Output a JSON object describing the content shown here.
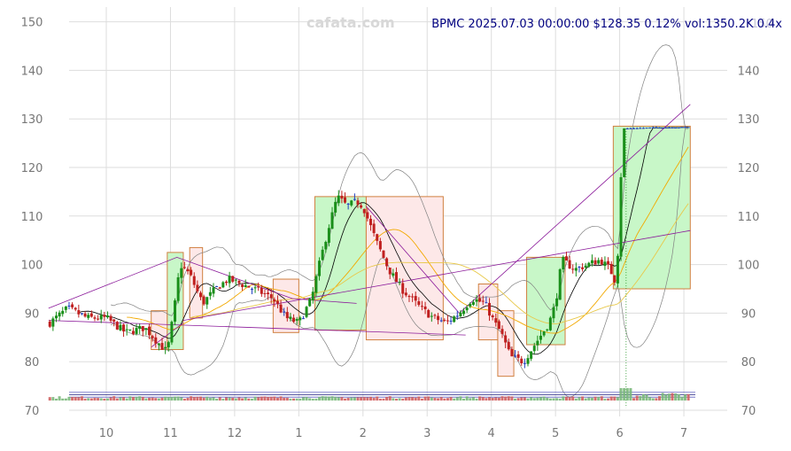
{
  "header": {
    "watermark": "cafata.com",
    "info": "BPMC 2025.07.03 00:00:00 $128.35 0.12% vol:1350.2K 0.4x",
    "overlay_num": "150"
  },
  "colors": {
    "up": "#1a8f1a",
    "down": "#c02020",
    "flat": "#1f3fbf",
    "grid": "#dddddd",
    "bb": "#808080",
    "ma_fast": "#000000",
    "ma_mid": "#f2a900",
    "ma_slow": "#e8c84a",
    "trend": "#8b1a9a",
    "up_box": "#c8f7c8",
    "down_box": "#fde8e8",
    "box_edge": "#d08040",
    "vol_up": "#7ab87a",
    "vol_down": "#d06060"
  },
  "chart_data": {
    "type": "candlestick",
    "symbol": "BPMC",
    "ylim": [
      70,
      152
    ],
    "y_ticks": [
      70,
      80,
      90,
      100,
      110,
      120,
      130,
      140,
      150
    ],
    "y_tick_labels": [
      "70",
      "80",
      "90",
      "100",
      "110",
      "120",
      "130",
      "140",
      "150"
    ],
    "x_ticks": [
      {
        "label": "10",
        "t": 1.0
      },
      {
        "label": "11",
        "t": 2.0
      },
      {
        "label": "12",
        "t": 3.0
      },
      {
        "label": "1",
        "t": 4.0
      },
      {
        "label": "2",
        "t": 5.0
      },
      {
        "label": "3",
        "t": 6.0
      },
      {
        "label": "4",
        "t": 7.0
      },
      {
        "label": "5",
        "t": 8.0
      },
      {
        "label": "6",
        "t": 9.0
      },
      {
        "label": "7",
        "t": 10.0
      }
    ],
    "x_range": [
      0.1,
      10.55
    ],
    "path_points": [
      [
        0.12,
        88
      ],
      [
        0.4,
        91
      ],
      [
        0.7,
        89
      ],
      [
        1.0,
        89
      ],
      [
        1.3,
        86
      ],
      [
        1.6,
        87
      ],
      [
        1.8,
        84
      ],
      [
        1.95,
        82
      ],
      [
        2.05,
        90
      ],
      [
        2.15,
        100
      ],
      [
        2.3,
        98
      ],
      [
        2.5,
        92
      ],
      [
        2.7,
        95
      ],
      [
        2.9,
        97
      ],
      [
        3.1,
        96
      ],
      [
        3.3,
        95
      ],
      [
        3.6,
        93
      ],
      [
        3.8,
        89
      ],
      [
        4.0,
        88
      ],
      [
        4.2,
        93
      ],
      [
        4.3,
        99
      ],
      [
        4.45,
        107
      ],
      [
        4.6,
        114
      ],
      [
        4.75,
        112
      ],
      [
        4.9,
        113
      ],
      [
        5.0,
        112
      ],
      [
        5.2,
        105
      ],
      [
        5.4,
        99
      ],
      [
        5.6,
        95
      ],
      [
        5.9,
        91
      ],
      [
        6.1,
        89
      ],
      [
        6.3,
        88
      ],
      [
        6.5,
        90
      ],
      [
        6.7,
        93
      ],
      [
        6.9,
        92
      ],
      [
        7.05,
        88
      ],
      [
        7.15,
        86
      ],
      [
        7.3,
        81
      ],
      [
        7.5,
        80
      ],
      [
        7.7,
        84
      ],
      [
        7.9,
        88
      ],
      [
        8.0,
        92
      ],
      [
        8.1,
        101
      ],
      [
        8.3,
        99
      ],
      [
        8.5,
        100
      ],
      [
        8.7,
        101
      ],
      [
        8.85,
        99
      ],
      [
        8.95,
        96
      ],
      [
        9.05,
        128
      ],
      [
        9.5,
        128.2
      ],
      [
        10.0,
        128.3
      ],
      [
        10.1,
        128.35
      ]
    ],
    "boxes": [
      {
        "x0": 1.7,
        "x1": 1.95,
        "low": 82.5,
        "high": 90.5,
        "kind": "down"
      },
      {
        "x0": 1.95,
        "x1": 2.2,
        "low": 82.5,
        "high": 102.5,
        "kind": "up"
      },
      {
        "x0": 2.3,
        "x1": 2.5,
        "low": 89,
        "high": 103.5,
        "kind": "down"
      },
      {
        "x0": 3.6,
        "x1": 4.0,
        "low": 86,
        "high": 97,
        "kind": "down"
      },
      {
        "x0": 4.25,
        "x1": 5.05,
        "low": 86.5,
        "high": 114,
        "kind": "up"
      },
      {
        "x0": 5.05,
        "x1": 6.25,
        "low": 84.5,
        "high": 114,
        "kind": "down"
      },
      {
        "x0": 6.8,
        "x1": 7.1,
        "low": 84.5,
        "high": 96,
        "kind": "down"
      },
      {
        "x0": 7.1,
        "x1": 7.35,
        "low": 77,
        "high": 90.5,
        "kind": "down"
      },
      {
        "x0": 7.55,
        "x1": 8.15,
        "low": 83.5,
        "high": 101.5,
        "kind": "up"
      },
      {
        "x0": 8.9,
        "x1": 10.1,
        "low": 95,
        "high": 128.5,
        "kind": "up"
      }
    ],
    "trend_lines": [
      [
        [
          0.1,
          91
        ],
        [
          2.1,
          101.5
        ],
        [
          3.9,
          93
        ]
      ],
      [
        [
          0.1,
          88.5
        ],
        [
          6.6,
          85.5
        ]
      ],
      [
        [
          1.7,
          83
        ],
        [
          2.2,
          88
        ]
      ],
      [
        [
          3.9,
          93
        ],
        [
          4.9,
          92
        ]
      ],
      [
        [
          5.05,
          112
        ],
        [
          6.5,
          90
        ]
      ],
      [
        [
          6.5,
          90
        ],
        [
          10.1,
          133
        ]
      ],
      [
        [
          2.2,
          88.5
        ],
        [
          10.1,
          107
        ]
      ]
    ],
    "last_close": 128.35,
    "change_pct": 0.12,
    "volume": "1350.2K",
    "volume_ratio": "0.4x"
  }
}
